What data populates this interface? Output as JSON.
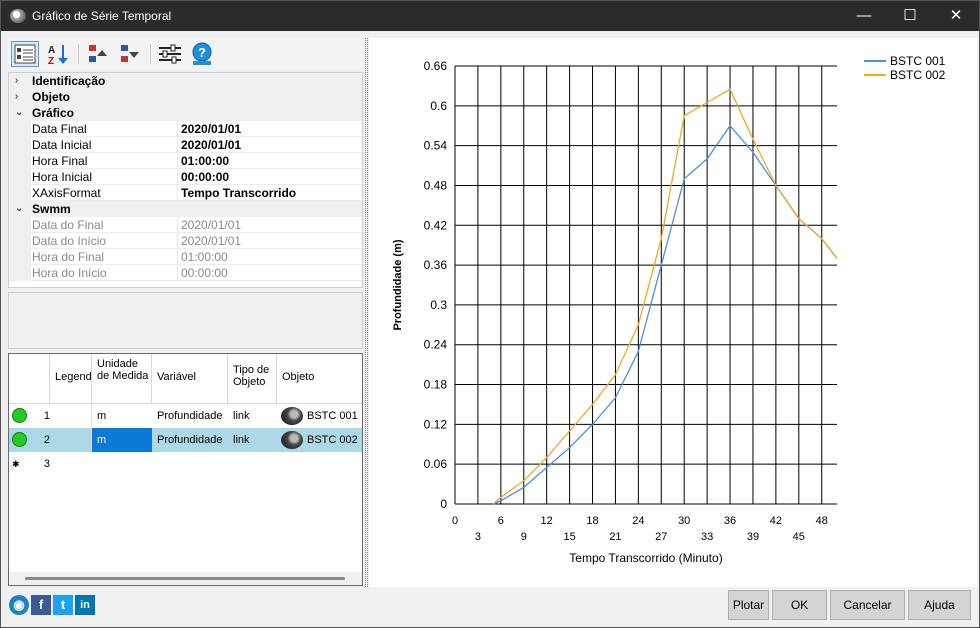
{
  "window": {
    "title": "Gráfico de Série Temporal",
    "minimize": "—",
    "maximize": "☐",
    "close": "✕"
  },
  "toolbar": {
    "icons": [
      "categorized-view-icon",
      "sort-az-icon",
      "move-up-icon",
      "move-down-icon",
      "settings-sliders-icon",
      "help-icon"
    ],
    "az_label_a": "A",
    "az_label_z": "Z"
  },
  "properties": {
    "cat_identificacao": "Identificação",
    "cat_objeto": "Objeto",
    "cat_grafico": "Gráfico",
    "grafico": [
      {
        "name": "Data Final",
        "value": "2020/01/01"
      },
      {
        "name": "Data Inicial",
        "value": "2020/01/01"
      },
      {
        "name": "Hora Final",
        "value": "01:00:00"
      },
      {
        "name": "Hora Inicial",
        "value": "00:00:00"
      },
      {
        "name": "XAxisFormat",
        "value": "Tempo Transcorrido"
      }
    ],
    "cat_swmm": "Swmm",
    "swmm": [
      {
        "name": "Data do Final",
        "value": "2020/01/01"
      },
      {
        "name": "Data do Início",
        "value": "2020/01/01"
      },
      {
        "name": "Hora do Final",
        "value": "01:00:00"
      },
      {
        "name": "Hora do Início",
        "value": "00:00:00"
      }
    ]
  },
  "grid": {
    "headers": {
      "legend": "Legend",
      "unit": "Unidade de Medida",
      "variable": "Variável",
      "object_type": "Tipo de Objeto",
      "object": "Objeto"
    },
    "rows": [
      {
        "index": "1",
        "status_color": "#22cc22",
        "unit": "m",
        "variable": "Profundidade",
        "object_type": "link",
        "object": "BSTC 001",
        "selected": false
      },
      {
        "index": "2",
        "status_color": "#22cc22",
        "unit": "m",
        "variable": "Profundidade",
        "object_type": "link",
        "object": "BSTC 002",
        "selected": true
      }
    ],
    "new_row": {
      "marker": "✱",
      "index": "3"
    }
  },
  "buttons": {
    "plot": "Plotar",
    "ok": "OK",
    "cancel": "Cancelar",
    "help": "Ajuda"
  },
  "social": {
    "facebook": "f",
    "twitter": "t",
    "linkedin": "in"
  },
  "chart_data": {
    "type": "line",
    "xlabel": "Tempo Transcorrido (Minuto)",
    "ylabel": "Profundidade (m)",
    "xlim": [
      0,
      50
    ],
    "ylim": [
      0,
      0.66
    ],
    "xticks_top": [
      0,
      6,
      12,
      18,
      24,
      30,
      36,
      42,
      48
    ],
    "xticks_bottom": [
      3,
      9,
      15,
      21,
      27,
      33,
      39,
      45
    ],
    "yticks": [
      0,
      0.06,
      0.12,
      0.18,
      0.24,
      0.3,
      0.36,
      0.42,
      0.48,
      0.54,
      0.6,
      0.66
    ],
    "grid": true,
    "legend_position": "top-right",
    "series": [
      {
        "name": "BSTC 001",
        "color": "#4a90e2",
        "x": [
          5,
          6,
          9,
          12,
          15,
          18,
          21,
          24,
          27,
          30,
          33,
          36,
          39,
          42,
          45,
          48,
          50
        ],
        "y": [
          0,
          0.005,
          0.025,
          0.055,
          0.085,
          0.12,
          0.16,
          0.23,
          0.36,
          0.49,
          0.52,
          0.57,
          0.53,
          0.48,
          0.43,
          0.4,
          0.37
        ]
      },
      {
        "name": "BSTC 002",
        "color": "#f5a623",
        "x": [
          5,
          6,
          9,
          12,
          15,
          18,
          21,
          24,
          27,
          30,
          33,
          36,
          39,
          42,
          45,
          48,
          50
        ],
        "y": [
          0,
          0.01,
          0.035,
          0.07,
          0.11,
          0.15,
          0.195,
          0.27,
          0.4,
          0.585,
          0.605,
          0.625,
          0.55,
          0.48,
          0.43,
          0.4,
          0.37
        ]
      }
    ]
  }
}
